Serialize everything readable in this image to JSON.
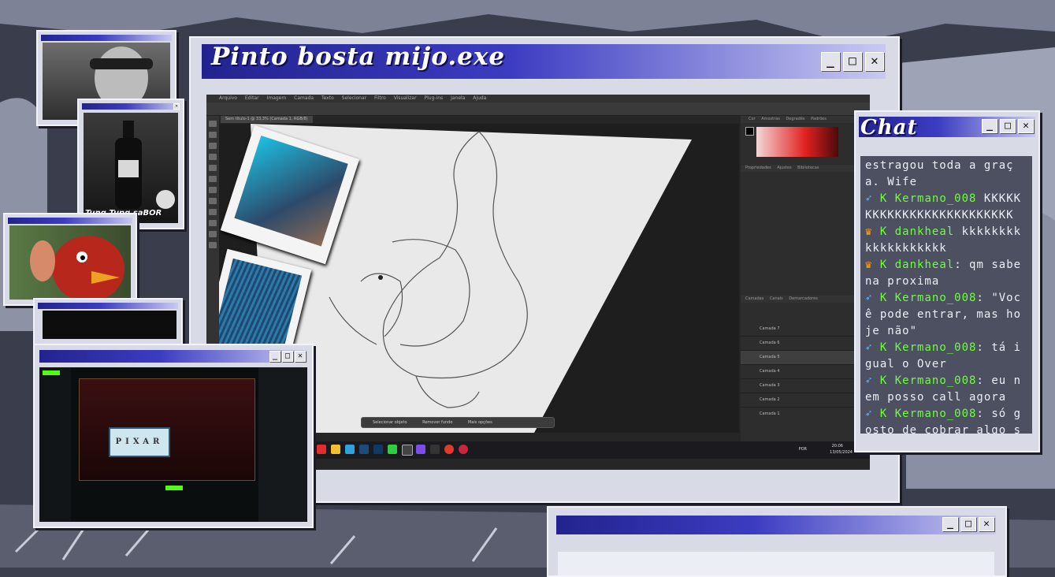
{
  "main_window": {
    "title": "Pinto bosta mijo.exe"
  },
  "window_controls": {
    "minimize": "_",
    "maximize": "□",
    "close": "✕"
  },
  "chat_window": {
    "title": "Chat"
  },
  "chat": {
    "messages": [
      {
        "text": "estragou toda a graça. Wife"
      },
      {
        "user": "Kermano_008",
        "text": "KKKKKKKKKKKKKKKKKKKKKKKKK"
      },
      {
        "user": "dankheal",
        "text": "kkkkkkkkkkkkkkkkkkk"
      },
      {
        "user": "dankheal",
        "text": "qm sabe na proxima"
      },
      {
        "user": "Kermano_008",
        "text": "\"Você pode entrar, mas hoje não\""
      },
      {
        "user": "Kermano_008",
        "text": "tá igual o Over"
      },
      {
        "user": "Kermano_008",
        "text": "eu nem posso call agora"
      },
      {
        "user": "Kermano_008",
        "text": "só gosto de cobrar algo sempre"
      }
    ]
  },
  "webcam_windows": {
    "overlay_caption": "Tung Tung saBOR"
  },
  "streamer_window": {
    "sign_text": "PIXAR"
  },
  "photoshop": {
    "tab_label": "Sem título-1 @ 33,3% (Camada 1, RGB/8)",
    "menu": [
      "Arquivo",
      "Editar",
      "Imagem",
      "Camada",
      "Texto",
      "Selecionar",
      "Filtro",
      "Visualizar",
      "Plug-ins",
      "Janela",
      "Ajuda"
    ],
    "panel_tabs": [
      "Cor",
      "Amostras",
      "Degradês",
      "Padrões"
    ],
    "properties_tabs": [
      "Propriedades",
      "Ajustes",
      "Bibliotecas"
    ],
    "layers_tabs": [
      "Camadas",
      "Canais",
      "Demarcadores"
    ],
    "layers": [
      "Camada 7",
      "Camada 6",
      "Camada 5",
      "Camada 4",
      "Camada 3",
      "Camada 2",
      "Camada 1"
    ],
    "context_bar": [
      "Selecionar objeto",
      "Remover fundo",
      "Mais opções"
    ]
  },
  "taskbar": {
    "time": "20:06",
    "date": "13/05/2024",
    "lang": "POR"
  },
  "colors": {
    "titlebar_start": "#23238f",
    "titlebar_end": "#c9c9f2",
    "chat_user": "#6dff3c",
    "badge_crown": "#ffa31a",
    "badge_pin": "#59b4ff"
  }
}
